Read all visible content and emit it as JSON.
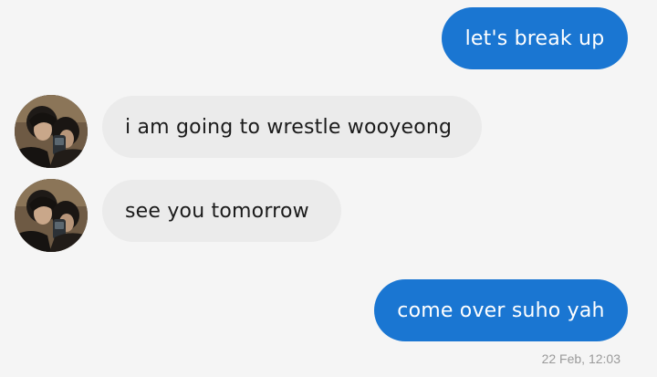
{
  "messages": [
    {
      "direction": "sent",
      "text": "let's break up"
    },
    {
      "direction": "received",
      "text": "i am going to wrestle wooyeong"
    },
    {
      "direction": "received",
      "text": "see you tomorrow"
    },
    {
      "direction": "sent",
      "text": "come over suho yah"
    }
  ],
  "timestamp": "22 Feb, 12:03",
  "colors": {
    "background": "#f5f5f5",
    "sent_bubble": "#1a76d2",
    "received_bubble": "#ebebeb",
    "timestamp_text": "#9a9a9a"
  },
  "icons": {
    "contact_avatar": "contact-avatar-photo"
  }
}
